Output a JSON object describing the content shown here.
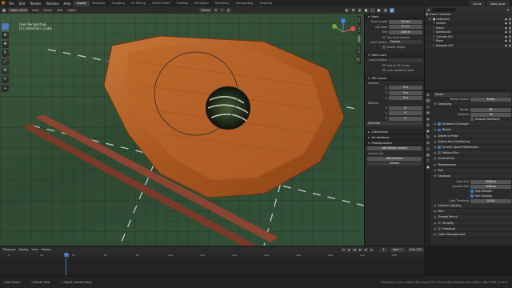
{
  "topbar": {
    "menus": [
      "File",
      "Edit",
      "Render",
      "Window",
      "Help"
    ],
    "workspaces": [
      "Layout",
      "Modeling",
      "Sculpting",
      "UV Editing",
      "Texture Paint",
      "Shading",
      "Animation",
      "Rendering",
      "Compositing",
      "Scripting"
    ],
    "active_workspace": "Layout",
    "scene": "Scene",
    "view_layer": "View Layer"
  },
  "viewport_header": {
    "mode": "Object Mode",
    "menus": [
      "View",
      "Select",
      "Add",
      "Object"
    ],
    "orientation": "Global"
  },
  "viewport": {
    "title": "User Perspective",
    "collection": "(1) Collection | Cube"
  },
  "view_tabs": [
    "Item",
    "Tool",
    "View",
    "Create",
    "Edit"
  ],
  "npanel": {
    "view_section": "View",
    "focal_length_label": "Focal Length",
    "focal_length": "50 mm",
    "clip_start_label": "Clip Start",
    "clip_start": "0.1 m",
    "clip_end_label": "End",
    "clip_end": "1000 m",
    "local_camera_label": "Use Local Camera",
    "local_camera_field_label": "Local Camera",
    "local_camera": "Camera",
    "render_region": "Render Region",
    "view_lock_section": "View Lock",
    "lock_object_label": "Lock to Object",
    "lock_3d_cursor": "Lock to 3D Cursor",
    "lock_camera": "Lock Camera to View",
    "cursor_section": "3D Cursor",
    "location_label": "Location",
    "rotation_label": "Rotation",
    "loc_x": "0 m",
    "loc_y": "0 m",
    "loc_z": "0 m",
    "rot_x": "0°",
    "rot_y": "0°",
    "rot_z": "0°",
    "rotation_mode": "XYZ Euler",
    "collections_section": "Collections",
    "annotations_section": "Annotations",
    "photographer_section": "Photographer",
    "add_master_camera": "Add Master Camera",
    "camera_list": "Camera List",
    "add_camera": "Add Camera",
    "camera_item": "Camera"
  },
  "outliner": {
    "title": "Scene Collection",
    "items": [
      {
        "icon": "collection-icon",
        "name": "Collection"
      },
      {
        "icon": "object-icon",
        "name": "Gardes"
      },
      {
        "icon": "object-icon",
        "name": "baton"
      },
      {
        "icon": "object-icon",
        "name": "bakedsushi"
      },
      {
        "icon": "object-icon",
        "name": "Cylinder.001"
      },
      {
        "icon": "object-icon",
        "name": "Plane"
      },
      {
        "icon": "object-icon",
        "name": "takoyaki.002"
      }
    ]
  },
  "properties": {
    "scene_name": "Scene",
    "render_engine": "Render Engine",
    "render_engine_value": "Eevee",
    "sampling": "Sampling",
    "render_label": "Render",
    "render_value": "64",
    "viewport_label": "Viewport",
    "viewport_value": "16",
    "viewport_denoising": "Viewport Denoising",
    "ambient_occlusion": "Ambient Occlusion",
    "bloom": "Bloom",
    "depth_of_field": "Depth of Field",
    "subsurface": "Subsurface Scattering",
    "screen_space_reflections": "Screen Space Reflections",
    "motion_blur": "Motion Blur",
    "volumetrics": "Volumetrics",
    "performance": "Performance",
    "hair": "Hair",
    "shadows": "Shadows",
    "cube_size_label": "Cube Size",
    "cube_size": "2048 px",
    "cascade_size_label": "Cascade Size",
    "cascade_size": "2048 px",
    "high_bitdepth": "High Bitdepth",
    "soft_shadows": "Soft Shadows",
    "light_threshold_label": "Light Threshold",
    "light_threshold": "0.010",
    "indirect_lighting": "Indirect Lighting",
    "film": "Film",
    "grease_pencil": "Grease Pencil",
    "simplify": "Simplify",
    "freestyle": "Freestyle",
    "color_management": "Color Management"
  },
  "timeline": {
    "menus": [
      "Playback",
      "Keying",
      "View",
      "Marker"
    ],
    "current_frame": "1",
    "start_label": "Start",
    "start": "1",
    "end_label": "End",
    "end": "250",
    "ticks": [
      "0",
      "20",
      "40",
      "60",
      "80",
      "100",
      "120",
      "140",
      "160",
      "180",
      "200",
      "220",
      "240"
    ]
  },
  "statusbar": {
    "select": "Box Select",
    "rotate": "Rotate View",
    "context": "Object Context Menu",
    "info": "Collection | Cube | Verts:798 | Faces:752 | Tris:1,436 | Objects:0/12 | Mem: 166.4 MiB | 2.82.6"
  },
  "colors": {
    "accent": "#4772b3",
    "brand": "#e87d0d",
    "grass": "#3d5a40",
    "wood": "#b8642a"
  }
}
